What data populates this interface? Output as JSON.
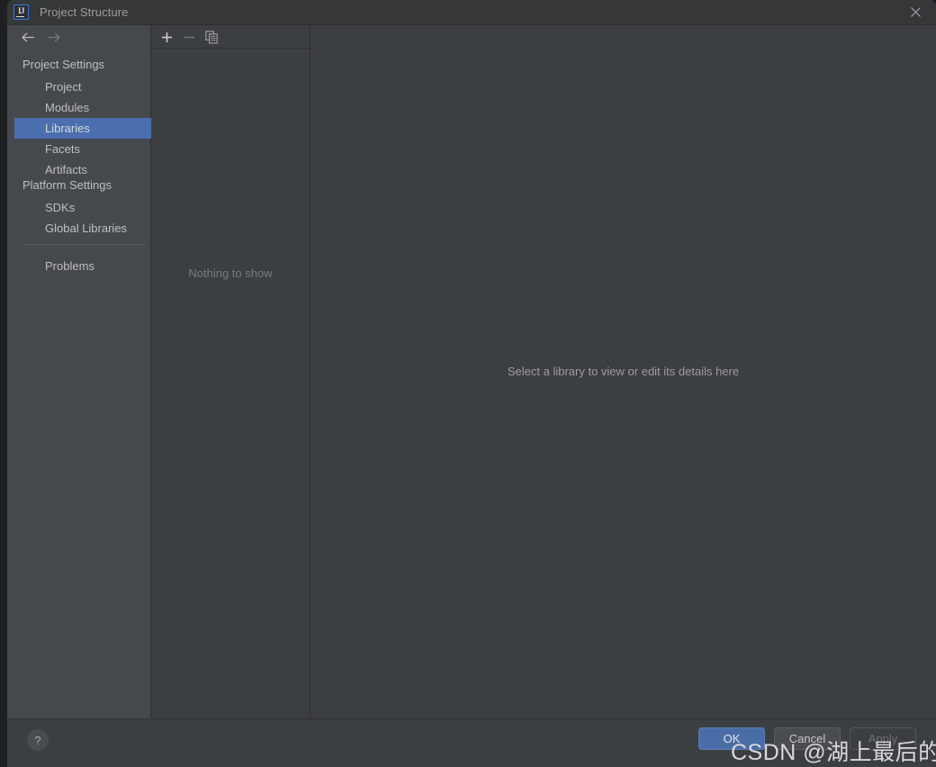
{
  "window": {
    "title": "Project Structure",
    "logo_icon": "intellij-idea-logo",
    "logo_text": "IJ",
    "close_icon": "close-icon"
  },
  "nav": {
    "back_icon": "arrow-left-icon",
    "forward_icon": "arrow-right-icon"
  },
  "sidebar": {
    "groups": [
      {
        "label": "Project Settings",
        "items": [
          {
            "label": "Project",
            "selected": false
          },
          {
            "label": "Modules",
            "selected": false
          },
          {
            "label": "Libraries",
            "selected": true
          },
          {
            "label": "Facets",
            "selected": false
          },
          {
            "label": "Artifacts",
            "selected": false
          }
        ]
      },
      {
        "label": "Platform Settings",
        "items": [
          {
            "label": "SDKs",
            "selected": false
          },
          {
            "label": "Global Libraries",
            "selected": false
          }
        ]
      }
    ],
    "extra_items": [
      {
        "label": "Problems",
        "selected": false
      }
    ]
  },
  "list_panel": {
    "toolbar": [
      {
        "name": "add-button",
        "icon": "plus-icon",
        "enabled": true
      },
      {
        "name": "remove-button",
        "icon": "minus-icon",
        "enabled": false
      },
      {
        "name": "copy-button",
        "icon": "copy-icon",
        "enabled": true
      }
    ],
    "empty_text": "Nothing to show"
  },
  "detail_panel": {
    "placeholder": "Select a library to view or edit its details here"
  },
  "bottom_bar": {
    "help_label": "?",
    "buttons": [
      {
        "label": "OK",
        "style": "default",
        "enabled": true
      },
      {
        "label": "Cancel",
        "style": "normal",
        "enabled": true
      },
      {
        "label": "Apply",
        "style": "disabled",
        "enabled": false
      }
    ]
  },
  "watermark": {
    "text": "CSDN @湖上最后的怨种"
  },
  "colors": {
    "dialog_bg": "#3c3f41",
    "sidebar_bg": "#45494e",
    "titlebar_bg": "#353739",
    "selection_blue": "#4b6eaf",
    "ok_button_blue": "#4a6da7",
    "text_primary": "#bdbfc1",
    "text_muted": "#787b7e",
    "border": "#2f3133"
  }
}
